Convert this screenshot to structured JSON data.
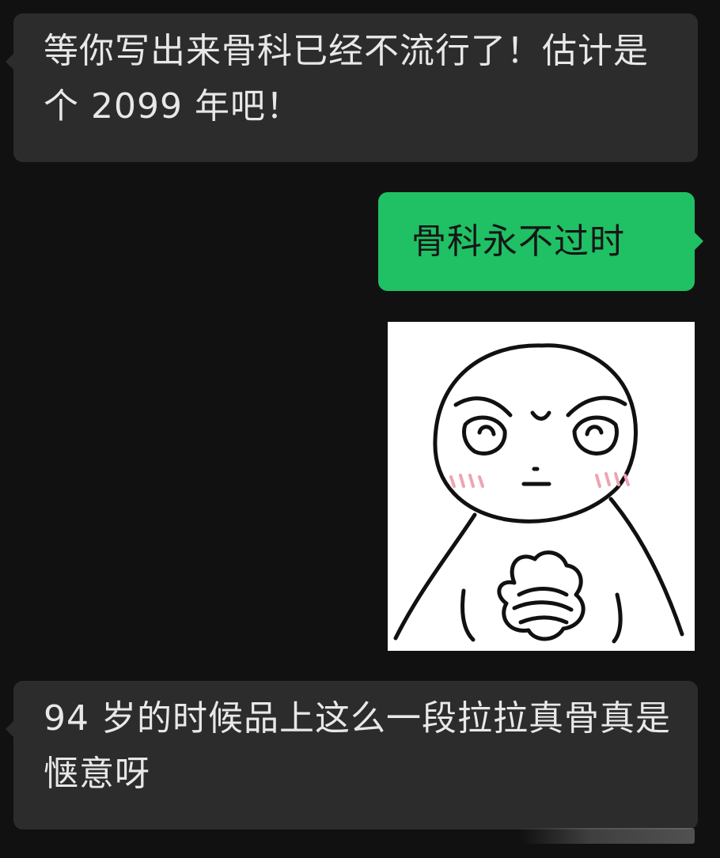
{
  "messages": [
    {
      "direction": "incoming",
      "text": "等你写出来骨科已经不流行了！估计是个 2099 年吧！"
    },
    {
      "direction": "outgoing",
      "text": "骨科永不过时"
    },
    {
      "direction": "outgoing",
      "type": "sticker",
      "icon": "determined-face-sticker-icon"
    },
    {
      "direction": "incoming",
      "text": "94 岁的时候品上这么一段拉拉真骨真是惬意呀"
    }
  ],
  "colors": {
    "background": "#111111",
    "incoming_bubble": "#2c2c2c",
    "outgoing_bubble": "#20c064",
    "incoming_text": "#e8e8e8",
    "outgoing_text": "#161616"
  }
}
